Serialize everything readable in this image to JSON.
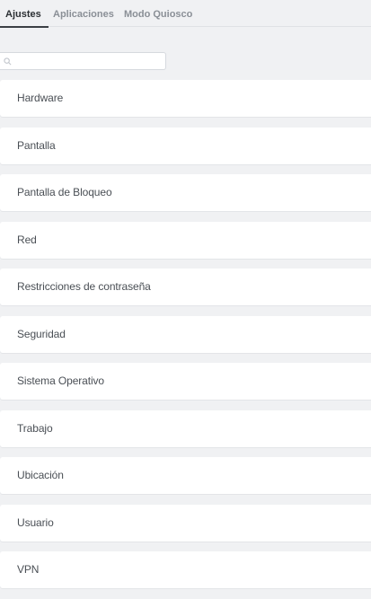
{
  "tabs": [
    {
      "label": "Ajustes"
    },
    {
      "label": "Aplicaciones"
    },
    {
      "label": "Modo Quiosco"
    }
  ],
  "search": {
    "placeholder": "",
    "value": "",
    "icon": "search-icon"
  },
  "settings": {
    "items": [
      {
        "label": "Hardware"
      },
      {
        "label": "Pantalla"
      },
      {
        "label": "Pantalla de Bloqueo"
      },
      {
        "label": "Red"
      },
      {
        "label": "Restricciones de contraseña"
      },
      {
        "label": "Seguridad"
      },
      {
        "label": "Sistema Operativo"
      },
      {
        "label": "Trabajo"
      },
      {
        "label": "Ubicación"
      },
      {
        "label": "Usuario"
      },
      {
        "label": "VPN"
      }
    ]
  }
}
